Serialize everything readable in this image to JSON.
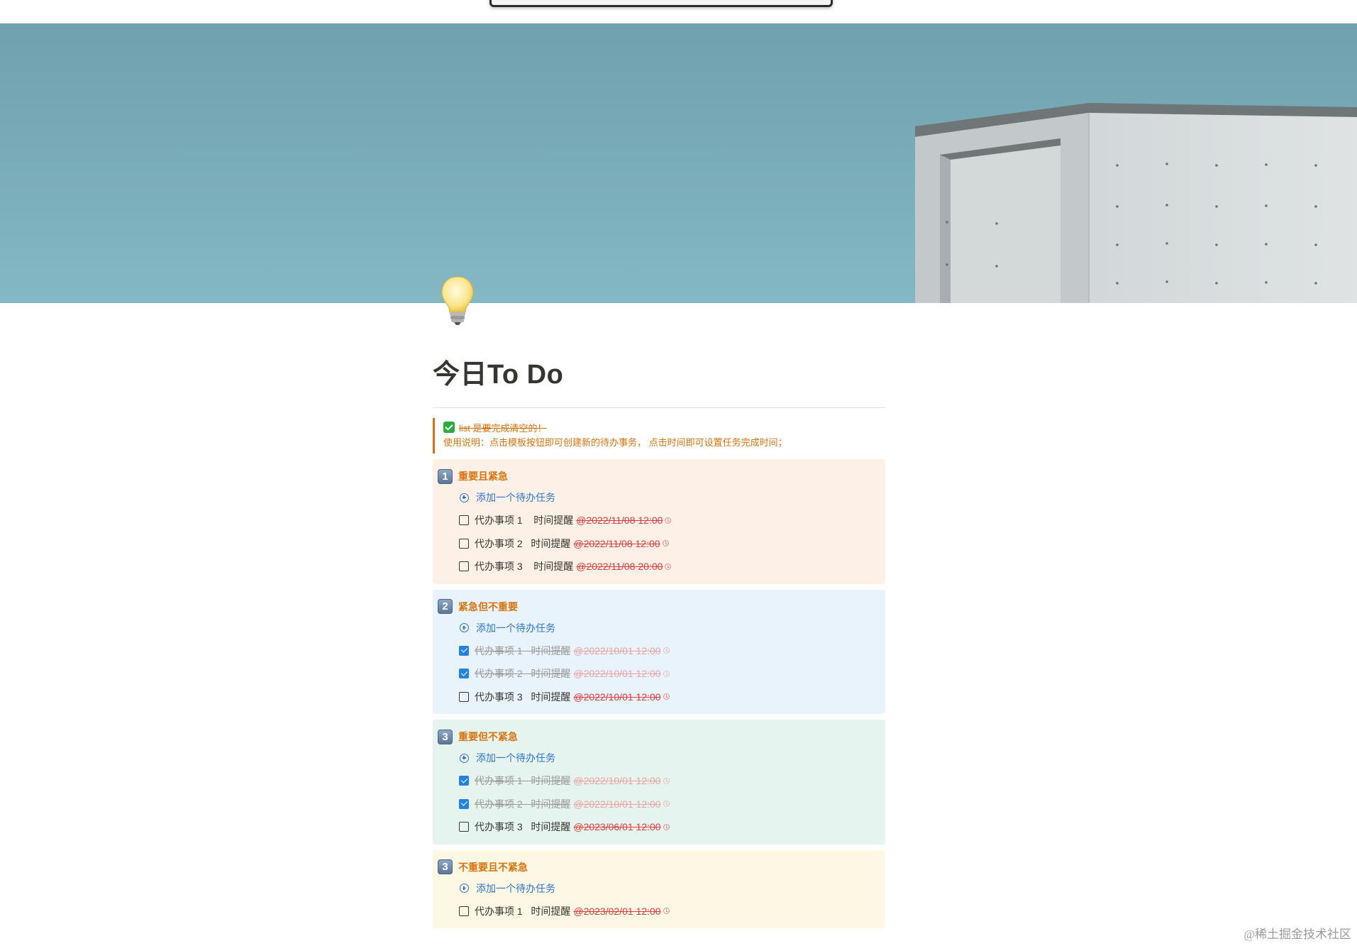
{
  "page": {
    "title": "今日To Do",
    "icon": "lightbulb-icon"
  },
  "callout": {
    "line1": "list 是要完成清空的！",
    "line2": "使用说明：点击模板按钮即可创建新的待办事务， 点击时间即可设置任务完成时间；",
    "icon": "check-mark-icon",
    "color": "#d9730d"
  },
  "add_label": "添加一个待办任务",
  "sections": [
    {
      "number": "1",
      "title": "重要且紧急",
      "bg": "#fdf1e7",
      "items": [
        {
          "text": "代办事项 1    时间提醒",
          "date": "@2022/11/08 12:00",
          "done": false
        },
        {
          "text": "代办事项 2   时间提醒",
          "date": "@2022/11/08 12:00",
          "done": false
        },
        {
          "text": "代办事项 3    时间提醒",
          "date": "@2022/11/08 20:00",
          "done": false
        }
      ]
    },
    {
      "number": "2",
      "title": "紧急但不重要",
      "bg": "#e8f3fc",
      "items": [
        {
          "text": "代办事项 1   时间提醒",
          "date": "@2022/10/01 12:00",
          "done": true
        },
        {
          "text": "代办事项 2   时间提醒",
          "date": "@2022/10/01 12:00",
          "done": true
        },
        {
          "text": "代办事项 3   时间提醒",
          "date": "@2022/10/01 12:00",
          "done": false
        }
      ]
    },
    {
      "number": "3",
      "title": "重要但不紧急",
      "bg": "#e6f4ef",
      "items": [
        {
          "text": "代办事项 1   时间提醒",
          "date": "@2022/10/01 12:00",
          "done": true
        },
        {
          "text": "代办事项 2   时间提醒",
          "date": "@2022/10/01 12:00",
          "done": true
        },
        {
          "text": "代办事项 3   时间提醒",
          "date": "@2023/06/01 12:00",
          "done": false
        }
      ]
    },
    {
      "number": "3",
      "title": "不重要且不紧急",
      "bg": "#fdf8e4",
      "items": [
        {
          "text": "代办事项 1   时间提醒",
          "date": "@2023/02/01 12:00",
          "done": false
        }
      ]
    }
  ],
  "watermark": "@稀土掘金技术社区"
}
